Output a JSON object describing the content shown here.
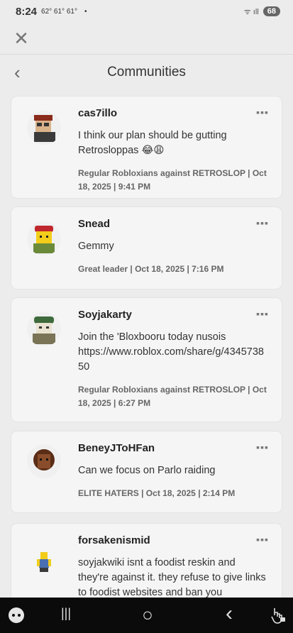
{
  "status": {
    "time": "8:24",
    "temps": "62° 61° 61°",
    "dot": "•",
    "signal": "ᯤ ıll",
    "battery": "68"
  },
  "header": {
    "close_icon": "close-icon",
    "back_icon": "chevron-left-icon",
    "title": "Communities"
  },
  "posts": [
    {
      "author": "cas7illo",
      "body": "I think our plan should be gutting Retrosloppas 😂😩",
      "meta": "Regular Robloxians against RETROSLOP | Oct 18, 2025 | 9:41 PM",
      "more": "▪▪▪"
    },
    {
      "author": "Snead",
      "body": "Gemmy",
      "meta": "Great leader | Oct 18, 2025 | 7:16 PM",
      "more": "▪▪▪"
    },
    {
      "author": "Soyjakarty",
      "body": "Join the 'Bloxbooru today nusois https://www.roblox.com/share/g/434573850",
      "meta": "Regular Robloxians against RETROSLOP | Oct 18, 2025 | 6:27 PM",
      "more": "▪▪▪"
    },
    {
      "author": "BeneyJToHFan",
      "body": "Can we focus on Parlo raiding",
      "meta": "ELITE HATERS | Oct 18, 2025 | 2:14 PM",
      "more": "▪▪▪"
    },
    {
      "author": "forsakenismid",
      "body": "soyjakwiki isnt a foodist reskin and they're against it. they refuse to give links to foodist websites and ban you",
      "meta": "",
      "more": "▪▪▪"
    }
  ],
  "navbar": {
    "game_icon": "gamepad-icon",
    "recents": "|||",
    "home": "○",
    "back": "‹",
    "accessibility_icon": "hand-lock-icon"
  },
  "colors": {
    "background": "#ececec",
    "card": "#f5f5f5",
    "navbar": "#0b0b0b"
  }
}
